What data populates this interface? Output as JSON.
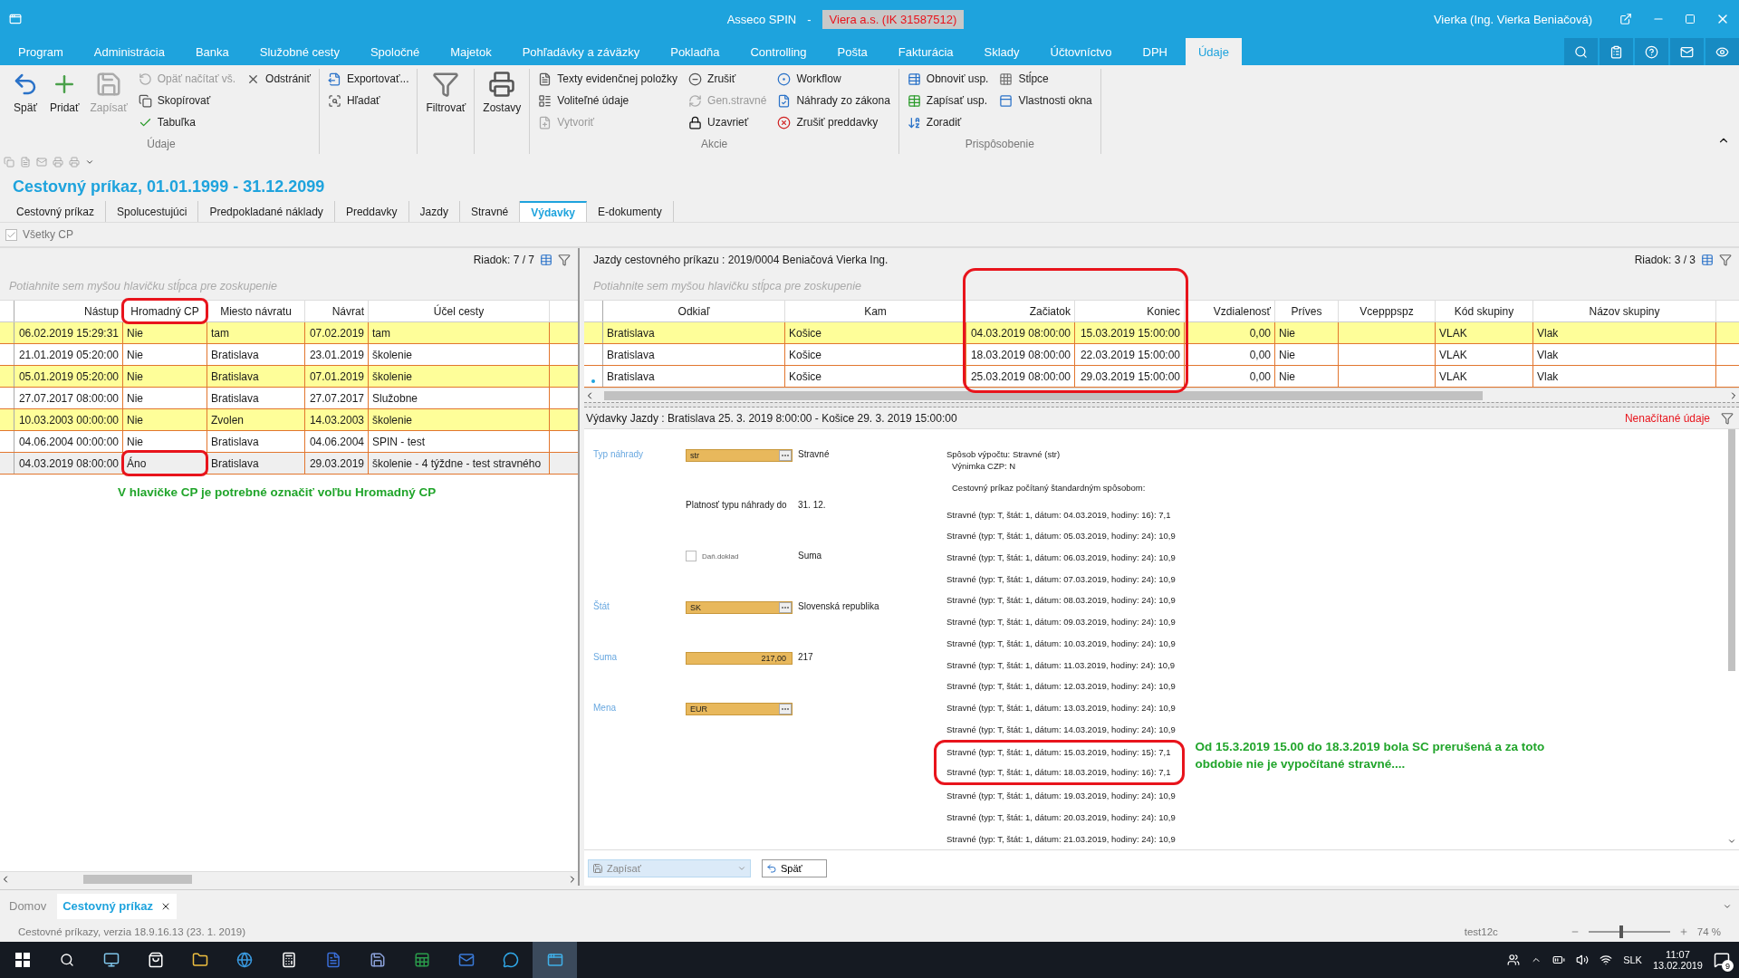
{
  "title_bar": {
    "app": "Asseco SPIN",
    "separator": "-",
    "company": "Viera a.s. (IK 31587512)",
    "user": "Vierka (Ing. Vierka Beniačová)"
  },
  "menu": [
    {
      "label": "Program",
      "selected": false
    },
    {
      "label": "Administrácia",
      "selected": false
    },
    {
      "label": "Banka",
      "selected": false
    },
    {
      "label": "Služobné cesty",
      "selected": false
    },
    {
      "label": "Spoločné",
      "selected": false
    },
    {
      "label": "Majetok",
      "selected": false
    },
    {
      "label": "Pohľadávky a záväzky",
      "selected": false
    },
    {
      "label": "Pokladňa",
      "selected": false
    },
    {
      "label": "Controlling",
      "selected": false
    },
    {
      "label": "Pošta",
      "selected": false
    },
    {
      "label": "Fakturácia",
      "selected": false
    },
    {
      "label": "Sklady",
      "selected": false
    },
    {
      "label": "Účtovníctvo",
      "selected": false
    },
    {
      "label": "DPH",
      "selected": false
    },
    {
      "label": "Údaje",
      "selected": true
    }
  ],
  "ribbon": {
    "groups": [
      {
        "label": "Údaje",
        "columns": [
          [
            {
              "label": "Späť",
              "kind": "large",
              "disabled": false
            }
          ],
          [
            {
              "label": "Pridať",
              "kind": "large",
              "disabled": false
            }
          ],
          [
            {
              "label": "Zapísať",
              "kind": "large",
              "disabled": true
            }
          ],
          [
            {
              "label": "Opäť načítať vš.",
              "kind": "small",
              "disabled": true
            },
            {
              "label": "Skopírovať",
              "kind": "small",
              "disabled": false
            },
            {
              "label": "Tabuľka",
              "kind": "small",
              "disabled": false
            }
          ],
          [
            {
              "label": "Odstrániť",
              "kind": "small",
              "disabled": false
            }
          ]
        ]
      },
      {
        "columns": [
          [
            {
              "label": "Exportovať...",
              "kind": "small",
              "disabled": false
            },
            {
              "label": "Hľadať",
              "kind": "small",
              "disabled": false
            }
          ]
        ]
      },
      {
        "columns": [
          [
            {
              "label": "Filtrovať",
              "kind": "large",
              "disabled": false
            }
          ]
        ]
      },
      {
        "columns": [
          [
            {
              "label": "Zostavy",
              "kind": "large",
              "disabled": false
            }
          ]
        ]
      },
      {
        "label": "Akcie",
        "columns": [
          [
            {
              "label": "Texty evidenčnej položky",
              "kind": "small",
              "disabled": false
            },
            {
              "label": "Voliteľné údaje",
              "kind": "small",
              "disabled": false
            },
            {
              "label": "Vytvoriť",
              "kind": "small",
              "disabled": true
            }
          ],
          [
            {
              "label": "Zrušiť",
              "kind": "small",
              "disabled": false
            },
            {
              "label": "Gen.stravné",
              "kind": "small",
              "disabled": true
            },
            {
              "label": "Uzavrieť",
              "kind": "small",
              "disabled": false
            }
          ],
          [
            {
              "label": "Workflow",
              "kind": "small",
              "disabled": false
            },
            {
              "label": "Náhrady zo zákona",
              "kind": "small",
              "disabled": false
            },
            {
              "label": "Zrušiť preddavky",
              "kind": "small",
              "disabled": false
            }
          ]
        ]
      },
      {
        "label": "Prispôsobenie",
        "columns": [
          [
            {
              "label": "Obnoviť usp.",
              "kind": "small",
              "disabled": false
            },
            {
              "label": "Zapísať usp.",
              "kind": "small",
              "disabled": false
            },
            {
              "label": "Zoradiť",
              "kind": "small",
              "disabled": false
            }
          ],
          [
            {
              "label": "Stĺpce",
              "kind": "small",
              "disabled": false
            },
            {
              "label": "Vlastnosti okna",
              "kind": "small",
              "disabled": false
            }
          ]
        ]
      }
    ]
  },
  "page_title": "Cestovný príkaz, 01.01.1999 - 31.12.2099",
  "tabs": [
    {
      "label": "Cestovný príkaz",
      "selected": false
    },
    {
      "label": "Spolucestujúci",
      "selected": false
    },
    {
      "label": "Predpokladané náklady",
      "selected": false
    },
    {
      "label": "Preddavky",
      "selected": false
    },
    {
      "label": "Jazdy",
      "selected": false
    },
    {
      "label": "Stravné",
      "selected": false
    },
    {
      "label": "Výdavky",
      "selected": true
    },
    {
      "label": "E-dokumenty",
      "selected": false
    }
  ],
  "all_cp": {
    "label": "Všetky CP",
    "checked": true
  },
  "left_grid": {
    "row_count": "Riadok: 7 / 7",
    "group_hint": "Potiahnite sem myšou hlavičku stĺpca pre zoskupenie",
    "columns": [
      {
        "label": "Nástup",
        "circled": false
      },
      {
        "label": "Hromadný CP",
        "circled": true
      },
      {
        "label": "Miesto návratu",
        "circled": false
      },
      {
        "label": "Návrat",
        "circled": false
      },
      {
        "label": "Účel cesty",
        "circled": false
      }
    ],
    "rows": [
      {
        "cells": [
          "06.02.2019 15:29:31",
          "Nie",
          "tam",
          "07.02.2019",
          "tam"
        ],
        "highlighted": true,
        "selected": false,
        "circled": false
      },
      {
        "cells": [
          "21.01.2019 05:20:00",
          "Nie",
          "Bratislava",
          "23.01.2019",
          "školenie"
        ],
        "highlighted": false,
        "selected": false,
        "circled": false
      },
      {
        "cells": [
          "05.01.2019 05:20:00",
          "Nie",
          "Bratislava",
          "07.01.2019",
          "školenie"
        ],
        "highlighted": true,
        "selected": false,
        "circled": false
      },
      {
        "cells": [
          "27.07.2017 08:00:00",
          "Nie",
          "Bratislava",
          "27.07.2017",
          "Služobne"
        ],
        "highlighted": false,
        "selected": false,
        "circled": false
      },
      {
        "cells": [
          "10.03.2003 00:00:00",
          "Nie",
          "Zvolen",
          "14.03.2003",
          "školenie"
        ],
        "highlighted": true,
        "selected": false,
        "circled": false
      },
      {
        "cells": [
          "04.06.2004 00:00:00",
          "Nie",
          "Bratislava",
          "04.06.2004",
          "SPIN - test"
        ],
        "highlighted": false,
        "selected": false,
        "circled": false
      },
      {
        "cells": [
          "04.03.2019 08:00:00",
          "Áno",
          "Bratislava",
          "29.03.2019",
          "školenie - 4 týždne - test stravného"
        ],
        "highlighted": false,
        "selected": true,
        "circled": true
      }
    ],
    "note": "V hlavičke CP je potrebné označiť voľbu Hromadný CP"
  },
  "right_grid": {
    "title": "Jazdy cestovného príkazu :  2019/0004 Beniačová Vierka Ing.",
    "row_count": "Riadok: 3 / 3",
    "group_hint": "Potiahnite sem myšou hlavičku stĺpca pre zoskupenie",
    "columns": [
      {
        "label": "Odkiaľ",
        "circled": false
      },
      {
        "label": "Kam",
        "circled": false
      },
      {
        "label": "Začiatok",
        "circled": true
      },
      {
        "label": "Koniec",
        "circled": true
      },
      {
        "label": "Vzdialenosť",
        "circled": false
      },
      {
        "label": "Príves",
        "circled": false
      },
      {
        "label": "Vcepppspz",
        "circled": false
      },
      {
        "label": "Kód skupiny",
        "circled": false
      },
      {
        "label": "Názov skupiny",
        "circled": false
      }
    ],
    "rows": [
      {
        "cells": [
          "Bratislava",
          "Košice",
          "04.03.2019 08:00:00",
          "15.03.2019 15:00:00",
          "0,00",
          "Nie",
          "",
          "VLAK",
          "Vlak"
        ],
        "highlighted": true,
        "selected": false
      },
      {
        "cells": [
          "Bratislava",
          "Košice",
          "18.03.2019 08:00:00",
          "22.03.2019 15:00:00",
          "0,00",
          "Nie",
          "",
          "VLAK",
          "Vlak"
        ],
        "highlighted": false,
        "selected": false
      },
      {
        "cells": [
          "Bratislava",
          "Košice",
          "25.03.2019 08:00:00",
          "29.03.2019 15:00:00",
          "0,00",
          "Nie",
          "",
          "VLAK",
          "Vlak"
        ],
        "highlighted": false,
        "selected": true
      }
    ]
  },
  "detail": {
    "title": "Výdavky Jazdy : Bratislava 25. 3. 2019 8:00:00 - Košice 29. 3. 2019 15:00:00",
    "status": "Nenačítané údaje",
    "form": [
      {
        "kind": "lookup",
        "label": "Typ náhrady",
        "value": "str",
        "text": "Stravné"
      },
      {
        "kind": "text",
        "label": "Platnosť typu náhrady do",
        "text": "31. 12."
      },
      {
        "kind": "checkbox",
        "label": "Daň.doklad",
        "checked": false,
        "text": "Suma"
      },
      {
        "kind": "lookup",
        "label": "Štát",
        "value": "SK",
        "text": "Slovenská republika"
      },
      {
        "kind": "amount",
        "label": "Suma",
        "value": "217,00",
        "text": "217"
      },
      {
        "kind": "lookup",
        "label": "Mena",
        "value": "EUR"
      }
    ],
    "calc_header": [
      "Spôsob výpočtu: Stravné (str)",
      "Výnimka CZP: N",
      "Cestovný príkaz počítaný štandardným spôsobom:"
    ],
    "calc_lines": [
      {
        "text": "Stravné (typ: T, štát: 1, dátum: 04.03.2019, hodiny: 16): 7,1",
        "circled": false
      },
      {
        "text": "Stravné (typ: T, štát: 1, dátum: 05.03.2019, hodiny: 24): 10,9",
        "circled": false
      },
      {
        "text": "Stravné (typ: T, štát: 1, dátum: 06.03.2019, hodiny: 24): 10,9",
        "circled": false
      },
      {
        "text": "Stravné (typ: T, štát: 1, dátum: 07.03.2019, hodiny: 24): 10,9",
        "circled": false
      },
      {
        "text": "Stravné (typ: T, štát: 1, dátum: 08.03.2019, hodiny: 24): 10,9",
        "circled": false
      },
      {
        "text": "Stravné (typ: T, štát: 1, dátum: 09.03.2019, hodiny: 24): 10,9",
        "circled": false
      },
      {
        "text": "Stravné (typ: T, štát: 1, dátum: 10.03.2019, hodiny: 24): 10,9",
        "circled": false
      },
      {
        "text": "Stravné (typ: T, štát: 1, dátum: 11.03.2019, hodiny: 24): 10,9",
        "circled": false
      },
      {
        "text": "Stravné (typ: T, štát: 1, dátum: 12.03.2019, hodiny: 24): 10,9",
        "circled": false
      },
      {
        "text": "Stravné (typ: T, štát: 1, dátum: 13.03.2019, hodiny: 24): 10,9",
        "circled": false
      },
      {
        "text": "Stravné (typ: T, štát: 1, dátum: 14.03.2019, hodiny: 24): 10,9",
        "circled": false
      },
      {
        "text": "Stravné (typ: T, štát: 1, dátum: 15.03.2019, hodiny: 15): 7,1",
        "circled": true
      },
      {
        "text": "Stravné (typ: T, štát: 1, dátum: 18.03.2019, hodiny: 16): 7,1",
        "circled": true
      },
      {
        "text": "Stravné (typ: T, štát: 1, dátum: 19.03.2019, hodiny: 24): 10,9",
        "circled": false
      },
      {
        "text": "Stravné (typ: T, štát: 1, dátum: 20.03.2019, hodiny: 24): 10,9",
        "circled": false
      },
      {
        "text": "Stravné (typ: T, štát: 1, dátum: 21.03.2019, hodiny: 24): 10,9",
        "circled": false
      }
    ],
    "note": "Od 15.3.2019 15.00 do 18.3.2019 bola SC prerušená a za toto obdobie nie je vypočítané stravné...."
  },
  "bottom_buttons": {
    "save": {
      "label": "Zapísať",
      "disabled": true
    },
    "back": {
      "label": "Späť"
    }
  },
  "doc_tabs": [
    {
      "label": "Domov",
      "selected": false
    },
    {
      "label": "Cestovný príkaz",
      "selected": true
    }
  ],
  "status_bar": {
    "text": "Cestovné príkazy, verzia 18.9.16.13 (23. 1. 2019)",
    "server": "test12c",
    "zoom": {
      "level": 0.4,
      "reading": "74 %"
    }
  },
  "taskbar": {
    "language": "SLK",
    "time": "11:07",
    "date": "13.02.2019",
    "notifications": "9"
  }
}
